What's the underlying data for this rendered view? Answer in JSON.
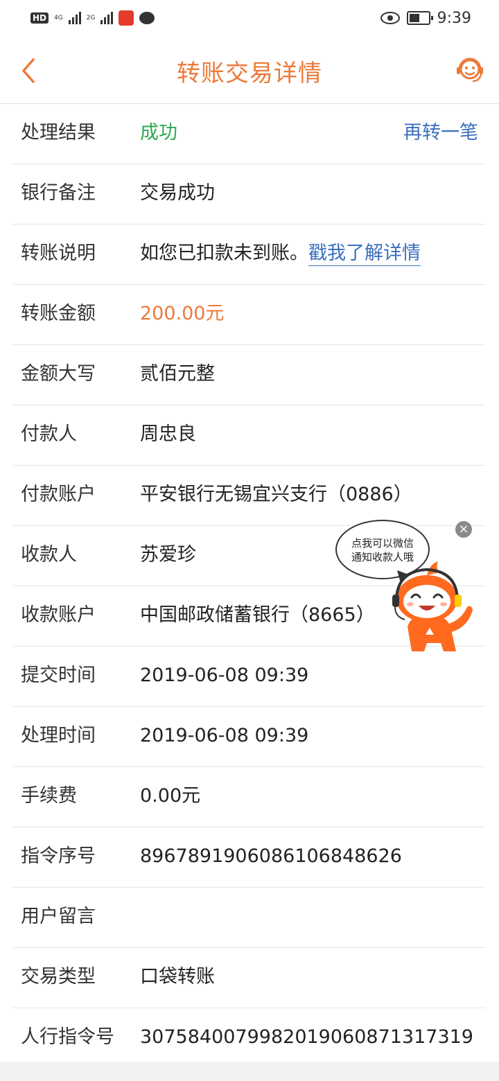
{
  "status_bar": {
    "network_1": "4G",
    "network_2": "2G",
    "hd": "HD",
    "time": "9:39"
  },
  "nav": {
    "title": "转账交易详情",
    "back_icon": "chevron-left-icon",
    "service_icon": "customer-service-icon"
  },
  "colors": {
    "accent": "#ec7a3a",
    "success": "#2aa952",
    "link": "#3b6fbf"
  },
  "details": {
    "result_label": "处理结果",
    "result_value": "成功",
    "transfer_again": "再转一笔",
    "bank_note_label": "银行备注",
    "bank_note_value": "交易成功",
    "explain_label": "转账说明",
    "explain_text": "如您已扣款未到账。",
    "explain_link": "戳我了解详情",
    "amount_label": "转账金额",
    "amount_value": "200.00元",
    "amount_upper_label": "金额大写",
    "amount_upper_value": "贰佰元整",
    "payer_label": "付款人",
    "payer_value": "周忠良",
    "payer_account_label": "付款账户",
    "payer_account_value": "平安银行无锡宜兴支行（0886）",
    "payee_label": "收款人",
    "payee_value": "苏爱珍",
    "payee_account_label": "收款账户",
    "payee_account_value": "中国邮政储蓄银行（8665）",
    "submit_time_label": "提交时间",
    "submit_time_value": "2019-06-08 09:39",
    "process_time_label": "处理时间",
    "process_time_value": "2019-06-08 09:39",
    "fee_label": "手续费",
    "fee_value": "0.00元",
    "instruction_label": "指令序号",
    "instruction_value": "8967891906086106848626",
    "message_label": "用户留言",
    "message_value": "",
    "type_label": "交易类型",
    "type_value": "口袋转账",
    "pboc_label": "人行指令号",
    "pboc_value": "307584007998201906087131​7319"
  },
  "mascot": {
    "bubble_line1": "点我可以微信",
    "bubble_line2": "通知收款人哦",
    "close_symbol": "×"
  }
}
